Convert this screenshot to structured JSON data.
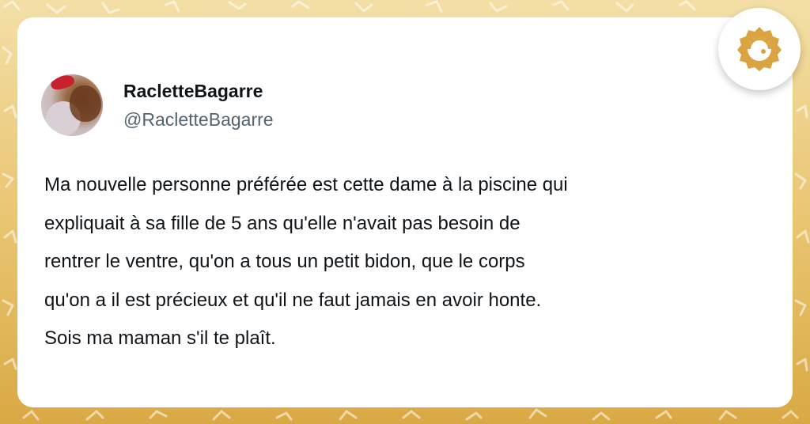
{
  "tweet": {
    "display_name": "RacletteBagarre",
    "handle": "@RacletteBagarre",
    "text_lines": [
      "Ma nouvelle personne préférée est cette dame à la piscine qui",
      "expliquait à sa fille de 5 ans qu'elle n'avait pas besoin de",
      "rentrer le ventre, qu'on a tous un petit bidon, que le corps",
      "qu'on a il est précieux et qu'il ne faut jamais en avoir honte.",
      "Sois ma maman s'il te plaît."
    ]
  },
  "icons": {
    "logo": "site-logo-icon",
    "avatar": "user-avatar"
  },
  "colors": {
    "background": "#e8c46e",
    "logo_accent": "#d9a441",
    "name_text": "#0f1419",
    "handle_text": "#536471"
  }
}
